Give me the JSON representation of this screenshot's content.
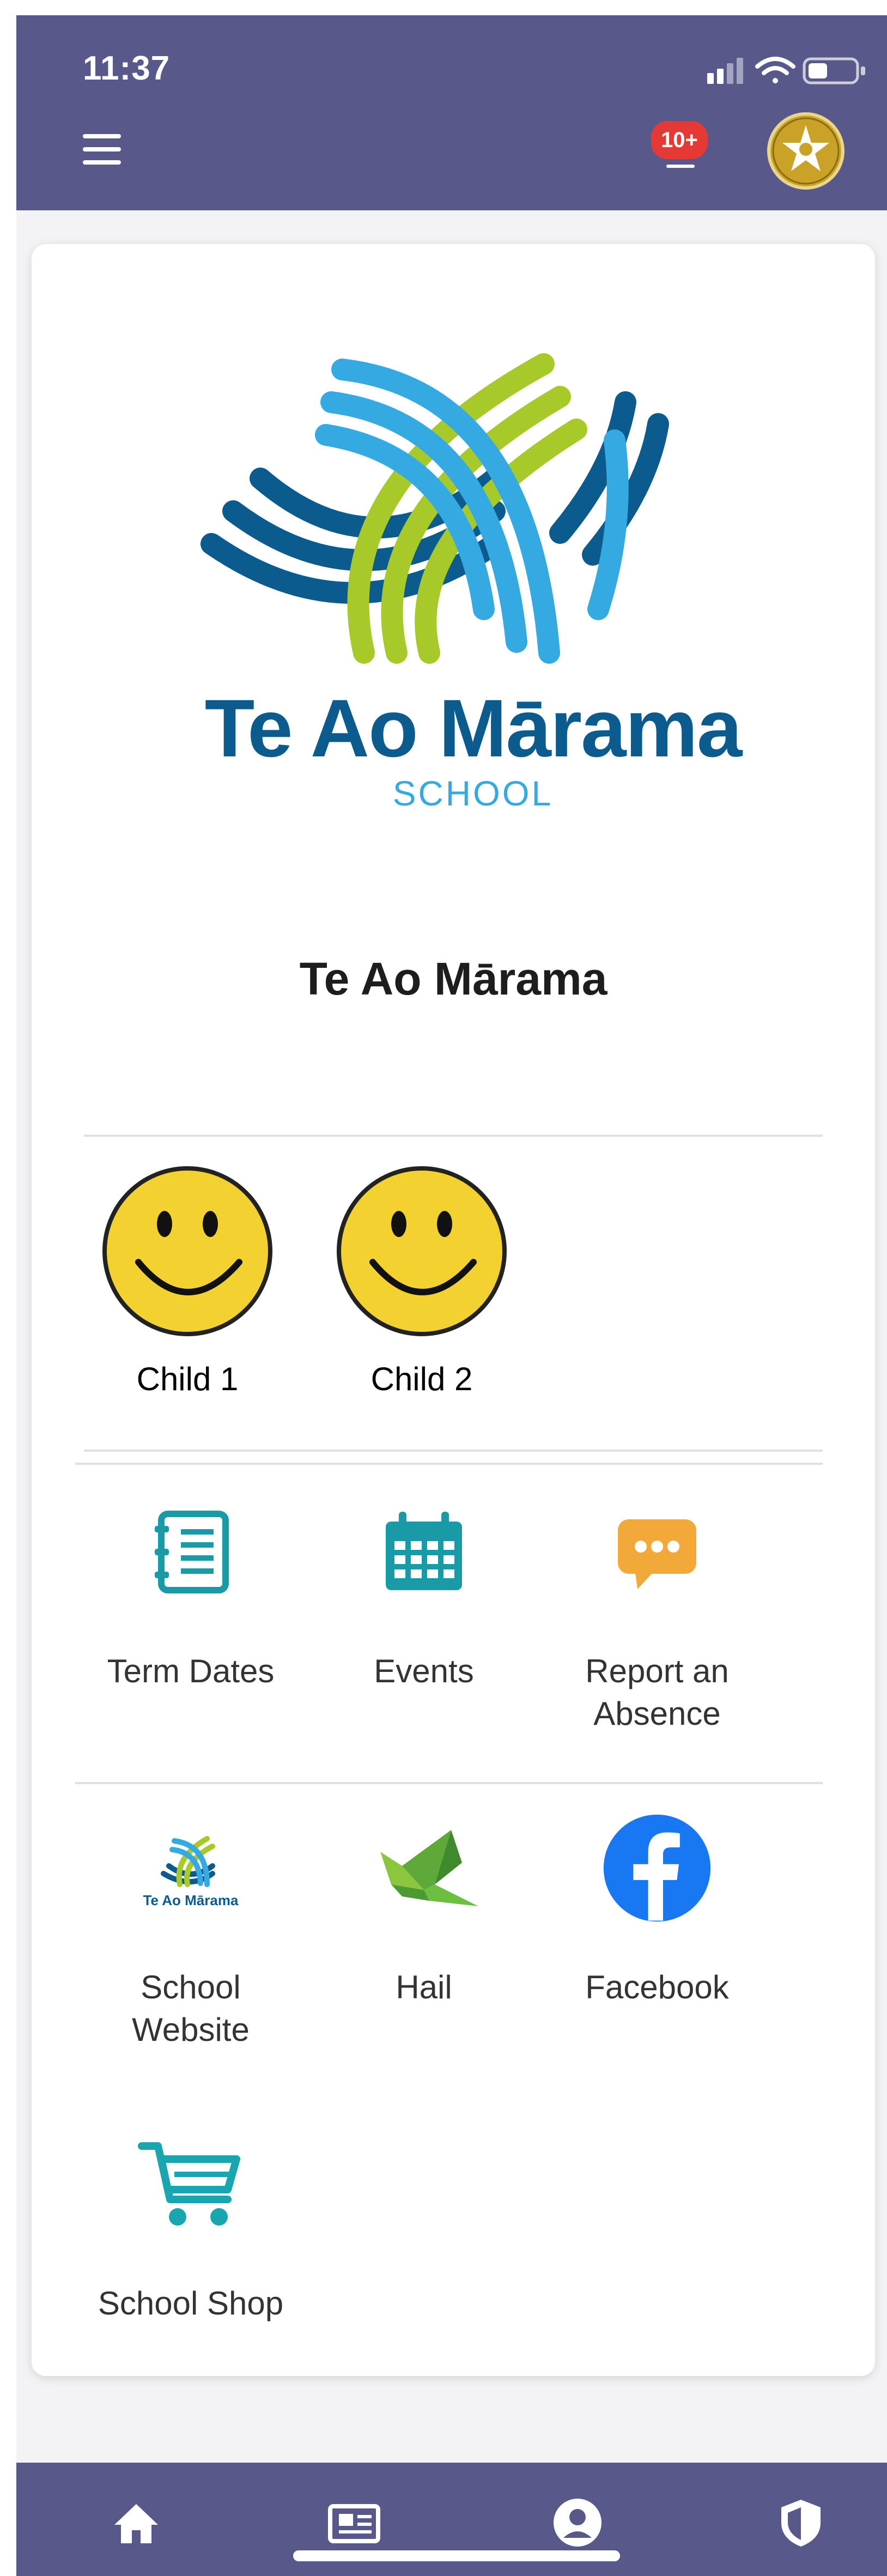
{
  "status_bar": {
    "time": "11:37"
  },
  "header": {
    "menu_icon": "hamburger-menu-icon",
    "notifications": {
      "badge": "10+",
      "icon": "bell-icon"
    },
    "avatar_icon": "school-crest-icon"
  },
  "school": {
    "logo": {
      "wordmark": "Te Ao Mārama",
      "sub": "SCHOOL"
    },
    "name": "Te Ao Mārama"
  },
  "children": [
    {
      "label": "Child 1",
      "icon": "smiley-face-icon"
    },
    {
      "label": "Child 2",
      "icon": "smiley-face-icon"
    }
  ],
  "tiles_row1": [
    {
      "label": "Term Dates",
      "icon": "notebook-icon"
    },
    {
      "label": "Events",
      "icon": "calendar-icon"
    },
    {
      "label": "Report an Absence",
      "icon": "chat-bubble-icon"
    }
  ],
  "tiles_row2": [
    {
      "label": "School Website",
      "icon": "school-logo-icon"
    },
    {
      "label": "Hail",
      "icon": "hail-bird-icon"
    },
    {
      "label": "Facebook",
      "icon": "facebook-icon"
    }
  ],
  "tiles_row3": [
    {
      "label": "School Shop",
      "icon": "shopping-cart-icon"
    }
  ],
  "bottom_nav": [
    {
      "icon": "home-icon"
    },
    {
      "icon": "newspaper-icon"
    },
    {
      "icon": "account-icon"
    },
    {
      "icon": "shield-icon"
    }
  ],
  "colors": {
    "bar": "#58598a",
    "brand_dark": "#0b5b8f",
    "brand_light": "#35a9e1",
    "brand_green": "#a8c92a",
    "teal": "#1a9aa6",
    "orange": "#f3a93a",
    "facebook": "#1877f2",
    "badge": "#e53935"
  }
}
